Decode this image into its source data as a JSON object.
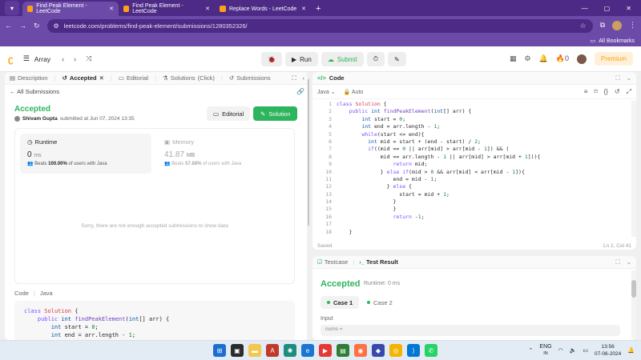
{
  "browser": {
    "tabs": [
      {
        "title": "Find Peak Element - LeetCode",
        "active": true
      },
      {
        "title": "Find Peak Element - LeetCode",
        "active": false
      },
      {
        "title": "Replace Words - LeetCode",
        "active": false
      }
    ],
    "url": "leetcode.com/problems/find-peak-element/submissions/1280352326/",
    "bookmarks_label": "All Bookmarks"
  },
  "nav": {
    "problem_list": "Array",
    "run": "Run",
    "submit": "Submit",
    "streak": "0",
    "premium": "Premium"
  },
  "left": {
    "tabs": [
      {
        "label": "Description"
      },
      {
        "label": "Accepted"
      },
      {
        "label": "Editorial"
      },
      {
        "label": "Solutions"
      },
      {
        "label": "(Click)"
      },
      {
        "label": "Submissions"
      }
    ],
    "all_submissions": "All Submissions",
    "status": "Accepted",
    "user": "Shivam Gupta",
    "submitted_text": "submitted at Jun 07, 2024 13:35",
    "editorial_btn": "Editorial",
    "solution_btn": "Solution",
    "runtime": {
      "label": "Runtime",
      "value": "0",
      "unit": "ms",
      "beats_prefix": "Beats",
      "beats_pct": "100.00%",
      "beats_suffix": "of users with Java"
    },
    "memory": {
      "label": "Memory",
      "value": "41.87",
      "unit": "MB",
      "beats_prefix": "Beats",
      "beats_pct": "57.88%",
      "beats_suffix": "of users with Java"
    },
    "sorry": "Sorry, there are not enough accepted submissions to show data",
    "code_label": "Code",
    "code_lang": "Java",
    "code_preview": [
      "class Solution {",
      "    public int findPeakElement(int[] arr) {",
      "        int start = 0;",
      "        int end = arr.length - 1;"
    ]
  },
  "editor": {
    "title": "Code",
    "lang": "Java",
    "auto": "Auto",
    "line_numbers": [
      "1",
      "2",
      "3",
      "4",
      "5",
      "6",
      "7",
      "8",
      "9",
      "10",
      "11",
      "12",
      "13",
      "14",
      "15",
      "16",
      "17",
      "18"
    ],
    "saved": "Saved",
    "cursor": "Ln 2, Col 41"
  },
  "result": {
    "testcase_tab": "Testcase",
    "result_tab": "Test Result",
    "status": "Accepted",
    "runtime": "Runtime: 0 ms",
    "case1": "Case 1",
    "case2": "Case 2",
    "input_label": "Input",
    "input_value": "nums ="
  },
  "taskbar": {
    "lang": "ENG",
    "lang_sub": "IN",
    "time": "13:56",
    "date": "07-06-2024"
  },
  "colors": {
    "accent": "#ffa116",
    "success": "#2db55d",
    "browser": "#6b4aa8"
  }
}
